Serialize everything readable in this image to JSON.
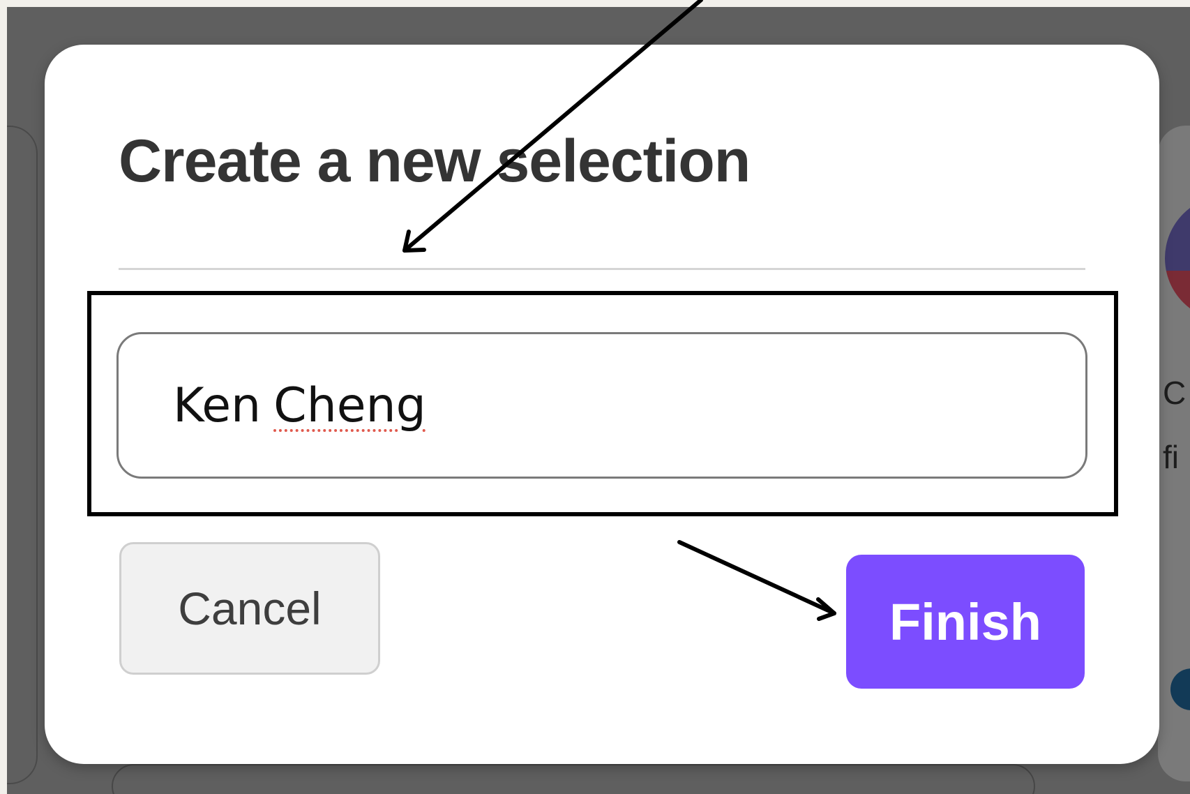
{
  "dialog": {
    "title": "Create a new selection",
    "input": {
      "value_first": "Ken",
      "value_second": "Cheng"
    },
    "cancel_label": "Cancel",
    "finish_label": "Finish"
  },
  "background": {
    "partial_text_1": "C",
    "partial_text_2": "fi"
  },
  "colors": {
    "finish_button": "#7c4dff",
    "overlay": "#5f5f5f",
    "annotation": "#000000"
  }
}
